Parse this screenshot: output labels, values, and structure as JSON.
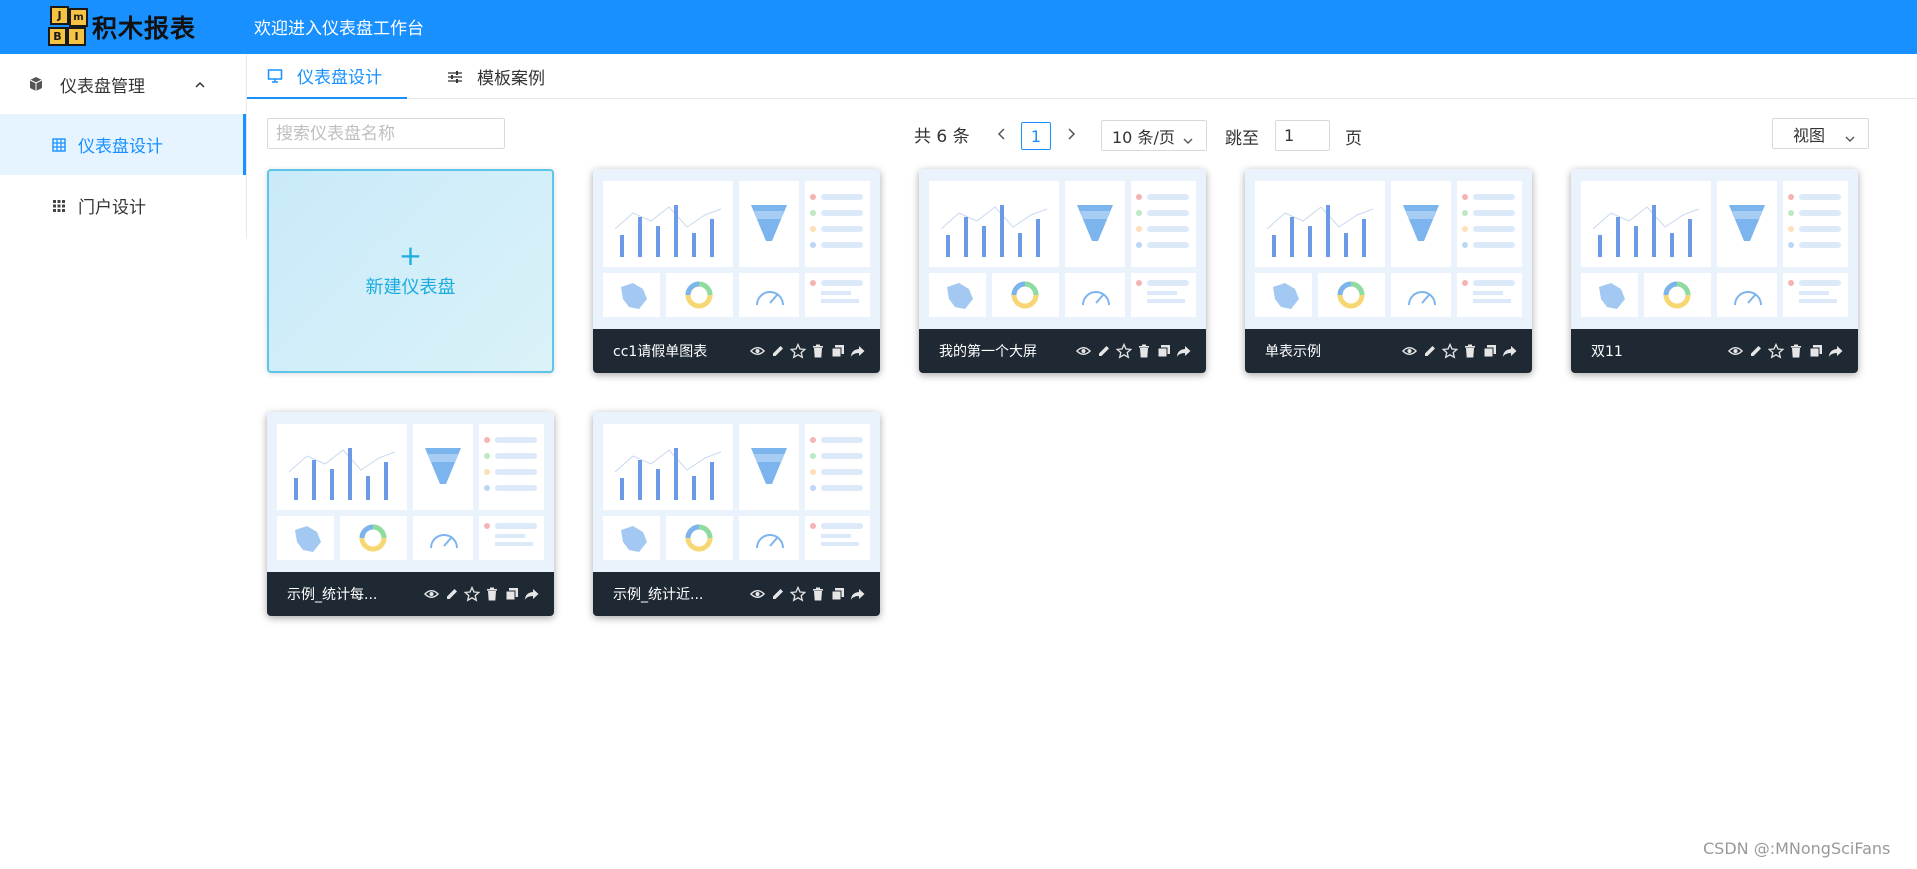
{
  "header": {
    "logo_text": "积木报表",
    "logo_letters": [
      "J",
      "m",
      "B",
      "I"
    ],
    "welcome": "欢迎进入仪表盘工作台"
  },
  "sidebar": {
    "group_label": "仪表盘管理",
    "items": [
      {
        "label": "仪表盘设计",
        "active": true
      },
      {
        "label": "门户设计",
        "active": false
      }
    ]
  },
  "tabs": [
    {
      "label": "仪表盘设计",
      "active": true
    },
    {
      "label": "模板案例",
      "active": false
    }
  ],
  "toolbar": {
    "search_placeholder": "搜索仪表盘名称",
    "total": "共 6 条",
    "current_page": "1",
    "page_size": "10 条/页",
    "jump_label": "跳至",
    "jump_value": "1",
    "jump_unit": "页",
    "view_label": "视图"
  },
  "new_card": {
    "plus": "+",
    "label": "新建仪表盘"
  },
  "cards": [
    {
      "title": "cc1请假单图表"
    },
    {
      "title": "我的第一个大屏"
    },
    {
      "title": "单表示例"
    },
    {
      "title": "双11"
    },
    {
      "title": "示例_统计每..."
    },
    {
      "title": "示例_统计近..."
    }
  ],
  "watermark": "CSDN @:MNongSciFans",
  "colors": {
    "primary": "#1890ff",
    "card_bar": "#1f2934",
    "new_card_text": "#1cacdf"
  }
}
